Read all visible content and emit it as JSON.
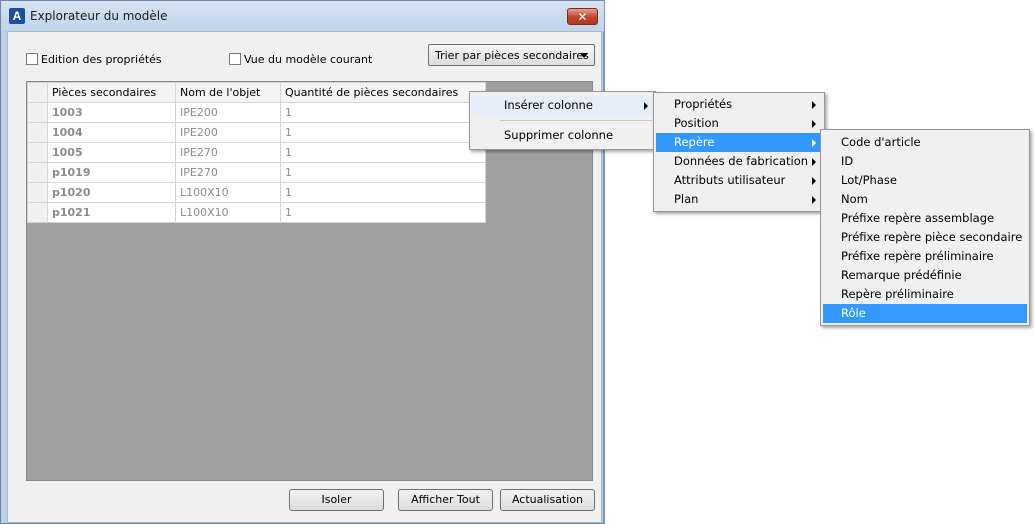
{
  "window": {
    "title": "Explorateur du modèle",
    "icon": "A",
    "close": "✕"
  },
  "options": {
    "edit_properties": "Edition des propriétés",
    "current_model_view": "Vue du modèle courant",
    "sort_by": "Trier par pièces secondaires"
  },
  "table": {
    "columns": [
      "Pièces secondaires",
      "Nom de l'objet",
      "Quantité de pièces secondaires"
    ],
    "rows": [
      [
        "1003",
        "IPE200",
        "1"
      ],
      [
        "1004",
        "IPE200",
        "1"
      ],
      [
        "1005",
        "IPE270",
        "1"
      ],
      [
        "p1019",
        "IPE270",
        "1"
      ],
      [
        "p1020",
        "L100X10",
        "1"
      ],
      [
        "p1021",
        "L100X10",
        "1"
      ]
    ]
  },
  "buttons": {
    "isolate": "Isoler",
    "show_all": "Afficher Tout",
    "refresh": "Actualisation"
  },
  "context_menu": {
    "insert_column": "Insérer colonne",
    "delete_column": "Supprimer colonne"
  },
  "submenu": {
    "items": [
      "Propriétés",
      "Position",
      "Repère",
      "Données de fabrication",
      "Attributs utilisateur",
      "Plan"
    ],
    "highlighted": "Repère"
  },
  "submenu2": {
    "items": [
      "Code d'article",
      "ID",
      "Lot/Phase",
      "Nom",
      "Préfixe repère assemblage",
      "Préfixe repère pièce secondaire",
      "Préfixe repère préliminaire",
      "Remarque prédéfinie",
      "Repère préliminaire",
      "Rôle"
    ],
    "highlighted": "Rôle"
  },
  "colors": {
    "highlight": "#3399ff",
    "grid_background": "#a0a0a0",
    "title_bar": "#bfd3ea"
  }
}
